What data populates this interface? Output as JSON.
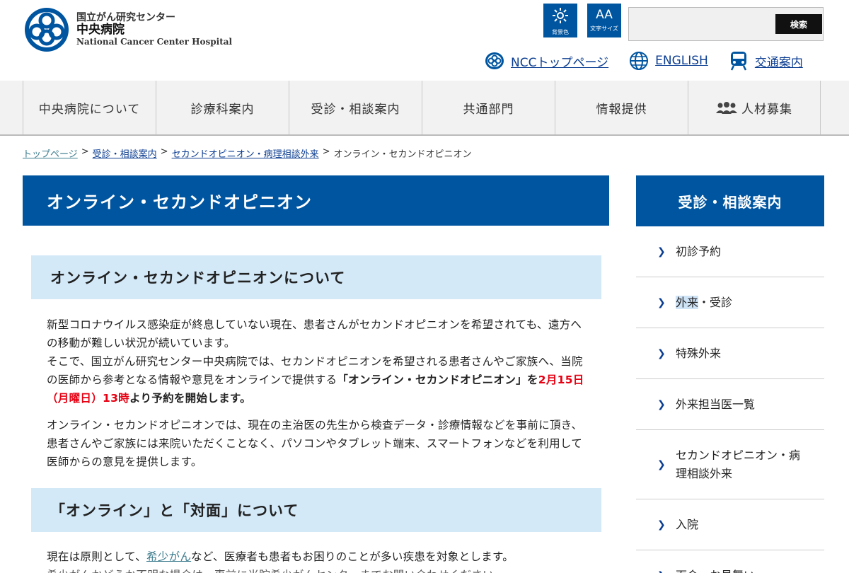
{
  "header": {
    "logo_line1": "国立がん研究センター",
    "logo_line2": "中央病院",
    "logo_line3": "National Cancer Center Hospital",
    "bg_color_label": "背景色",
    "font_size_label": "文字サイズ",
    "font_size_glyph": "AA",
    "search_placeholder": "",
    "search_button": "検索",
    "util_links": [
      "NCCトップページ",
      "ENGLISH",
      "交通案内"
    ]
  },
  "gnav": [
    "中央病院について",
    "診療科案内",
    "受診・相談案内",
    "共通部門",
    "情報提供",
    "人材募集"
  ],
  "breadcrumb": {
    "items": [
      "トップページ",
      "受診・相談案内",
      "セカンドオピニオン・病理相談外来"
    ],
    "current": "オンライン・セカンドオピニオン",
    "separator": ">"
  },
  "main": {
    "title": "オンライン・セカンドオピニオン",
    "section1_heading": "オンライン・セカンドオピニオンについて",
    "p1_a": "新型コロナウイルス感染症が終息していない現在、患者さんがセカンドオピニオンを希望されても、遠方への移動が難しい状況が続いています。",
    "p1_b": "そこで、国立がん研究センター中央病院では、セカンドオピニオンを希望される患者さんやご家族へ、当院の医師から参考となる情報や意見をオンラインで提供する",
    "p1_strong": "「オンライン・セカンドオピニオン」を",
    "p1_red": "2月15日（月曜日）13時",
    "p1_tail": "より予約を開始します。",
    "p2": "オンライン・セカンドオピニオンでは、現在の主治医の先生から検査データ・診療情報などを事前に頂き、患者さんやご家族には来院いただくことなく、パソコンやタブレット端末、スマートフォンなどを利用して医師からの意見を提供します。",
    "section2_heading": "「オンライン」と「対面」について",
    "p3_a": "現在は原則として、",
    "p3_link": "希少がん",
    "p3_b": "など、医療者も患者もお困りのことが多い疾患を対象とします。",
    "p4": "希少がんかどうか不明な場合は、事前に当院希少がんセンターまでお問い合わせください。"
  },
  "sidebar": {
    "title": "受診・相談案内",
    "items": [
      {
        "label": "初診予約"
      },
      {
        "label_hl": "外来",
        "label_rest": "・受診"
      },
      {
        "label": "特殊外来"
      },
      {
        "label": "外来担当医一覧"
      },
      {
        "label": "セカンドオピニオン・病理相談外来"
      },
      {
        "label": "入院"
      },
      {
        "label": "面会・お見舞い"
      }
    ]
  },
  "colors": {
    "brand_blue": "#0055a0",
    "section_bg": "#d3e9f8",
    "emphasis_red": "#e60012"
  }
}
